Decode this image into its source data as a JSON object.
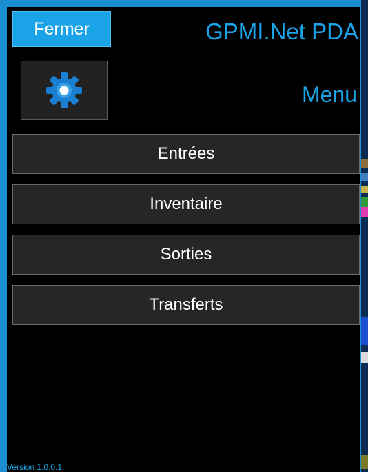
{
  "header": {
    "close_label": "Fermer",
    "app_title": "GPMI.Net PDA",
    "page_title": "Menu",
    "settings_icon": "gear-icon"
  },
  "menu": {
    "items": [
      {
        "label": "Entrées"
      },
      {
        "label": "Inventaire"
      },
      {
        "label": "Sorties"
      },
      {
        "label": "Transferts"
      }
    ]
  },
  "footer": {
    "version": "Version 1.0.0.1"
  },
  "colors": {
    "accent": "#1aa3e6",
    "background": "#000000",
    "button": "#262626",
    "frame": "#1c8fd4"
  }
}
